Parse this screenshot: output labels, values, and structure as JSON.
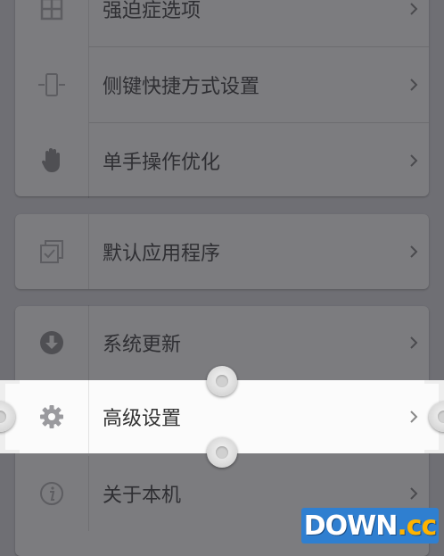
{
  "menu": {
    "group1": [
      {
        "label": "强迫症选项",
        "icon": "grid-icon"
      },
      {
        "label": "侧键快捷方式设置",
        "icon": "side-key-icon"
      },
      {
        "label": "单手操作优化",
        "icon": "hand-icon"
      }
    ],
    "group2": [
      {
        "label": "默认应用程序",
        "icon": "default-apps-icon"
      }
    ],
    "group3": [
      {
        "label": "系统更新",
        "icon": "download-icon"
      },
      {
        "label": "高级设置",
        "icon": "gear-icon"
      },
      {
        "label": "关于本机",
        "icon": "info-icon"
      }
    ]
  },
  "watermark": {
    "main": "DOWN",
    "suffix": ".cc"
  }
}
